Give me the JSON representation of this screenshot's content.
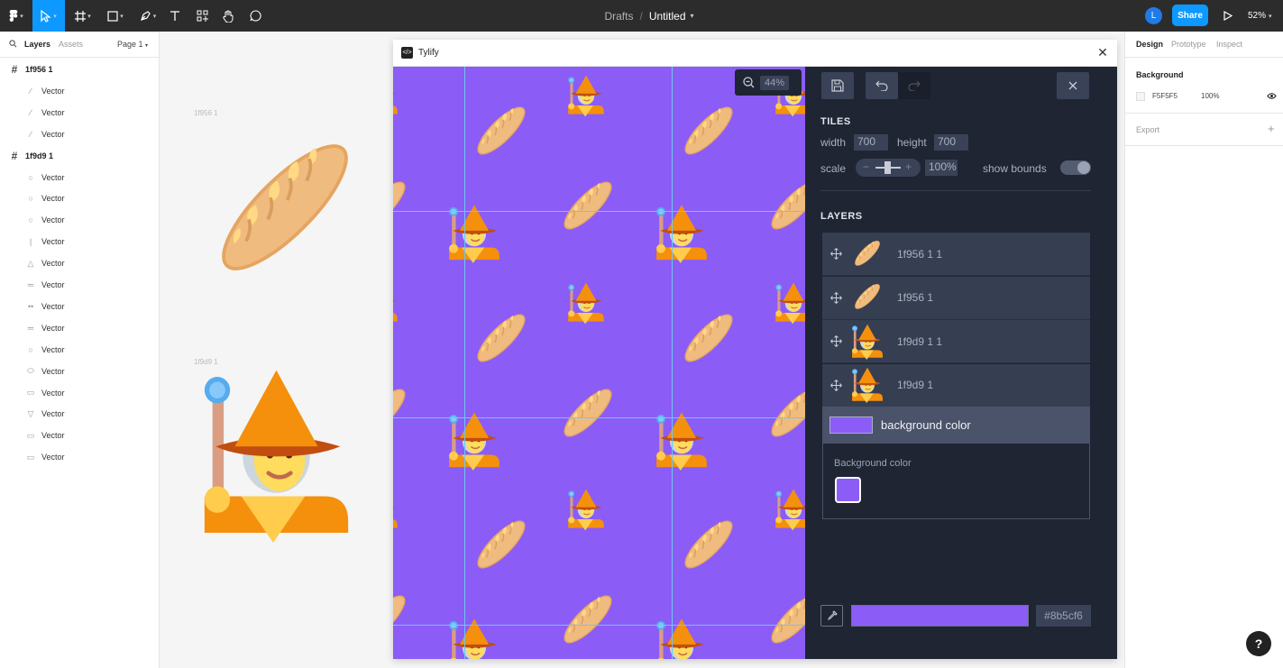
{
  "toolbar": {
    "breadcrumb_parent": "Drafts",
    "breadcrumb_sep": "/",
    "file_title": "Untitled",
    "avatar_initial": "L",
    "share_label": "Share",
    "zoom": "52%"
  },
  "left_panel": {
    "tabs": [
      "Layers",
      "Assets"
    ],
    "page": "Page 1",
    "layers": [
      {
        "label": "1f956 1",
        "type": "frame"
      },
      {
        "label": "Vector",
        "type": "vector"
      },
      {
        "label": "Vector",
        "type": "vector"
      },
      {
        "label": "Vector",
        "type": "vector"
      },
      {
        "label": "1f9d9 1",
        "type": "frame"
      },
      {
        "label": "Vector",
        "type": "vector"
      },
      {
        "label": "Vector",
        "type": "vector"
      },
      {
        "label": "Vector",
        "type": "vector"
      },
      {
        "label": "Vector",
        "type": "vector"
      },
      {
        "label": "Vector",
        "type": "vector"
      },
      {
        "label": "Vector",
        "type": "vector"
      },
      {
        "label": "Vector",
        "type": "vector"
      },
      {
        "label": "Vector",
        "type": "vector"
      },
      {
        "label": "Vector",
        "type": "vector"
      },
      {
        "label": "Vector",
        "type": "vector"
      },
      {
        "label": "Vector",
        "type": "vector"
      },
      {
        "label": "Vector",
        "type": "vector"
      },
      {
        "label": "Vector",
        "type": "vector"
      },
      {
        "label": "Vector",
        "type": "vector"
      }
    ]
  },
  "canvas": {
    "frames": [
      {
        "label": "1f956 1",
        "icon": "baguette-icon"
      },
      {
        "label": "1f9d9 1",
        "icon": "mage-icon"
      }
    ]
  },
  "plugin": {
    "title": "Tylify",
    "zoom": "44%",
    "background_color": "#8b5cf6",
    "tiles": {
      "title": "TILES",
      "width_label": "width",
      "width_value": "700",
      "height_label": "height",
      "height_value": "700",
      "scale_label": "scale",
      "scale_value": "100%",
      "show_bounds_label": "show bounds",
      "show_bounds": false
    },
    "layers_title": "LAYERS",
    "layers": [
      {
        "name": "1f956 1 1",
        "icon": "baguette-icon"
      },
      {
        "name": "1f956 1",
        "icon": "baguette-icon"
      },
      {
        "name": "1f9d9 1 1",
        "icon": "mage-icon"
      },
      {
        "name": "1f9d9 1",
        "icon": "mage-icon"
      }
    ],
    "bg_row_label": "background color",
    "bg_section_label": "Background color",
    "hex_value": "#8b5cf6"
  },
  "right_panel": {
    "tabs": [
      "Design",
      "Prototype",
      "Inspect"
    ],
    "background_title": "Background",
    "background_hex": "F5F5F5",
    "background_opacity": "100%",
    "export_label": "Export"
  },
  "help_label": "?"
}
